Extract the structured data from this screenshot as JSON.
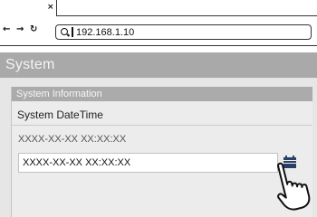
{
  "browser": {
    "tab_close": "×",
    "back": "←",
    "forward": "→",
    "reload": "↻",
    "address": "192.168.1.10"
  },
  "page": {
    "title": "System",
    "panel": {
      "header": "System Information",
      "section_label": "System DateTime",
      "current_value": "XXXX-XX-XX XX:XX:XX",
      "input_value": "XXXX-XX-XX XX:XX:XX"
    }
  },
  "icons": {
    "calendar": "calendar-icon",
    "cursor": "pointing-hand-icon",
    "search": "search-icon"
  },
  "colors": {
    "title_bar": "#a9a9a9",
    "page_bg": "#e6e6e6",
    "accent_icon": "#2a3f66"
  }
}
